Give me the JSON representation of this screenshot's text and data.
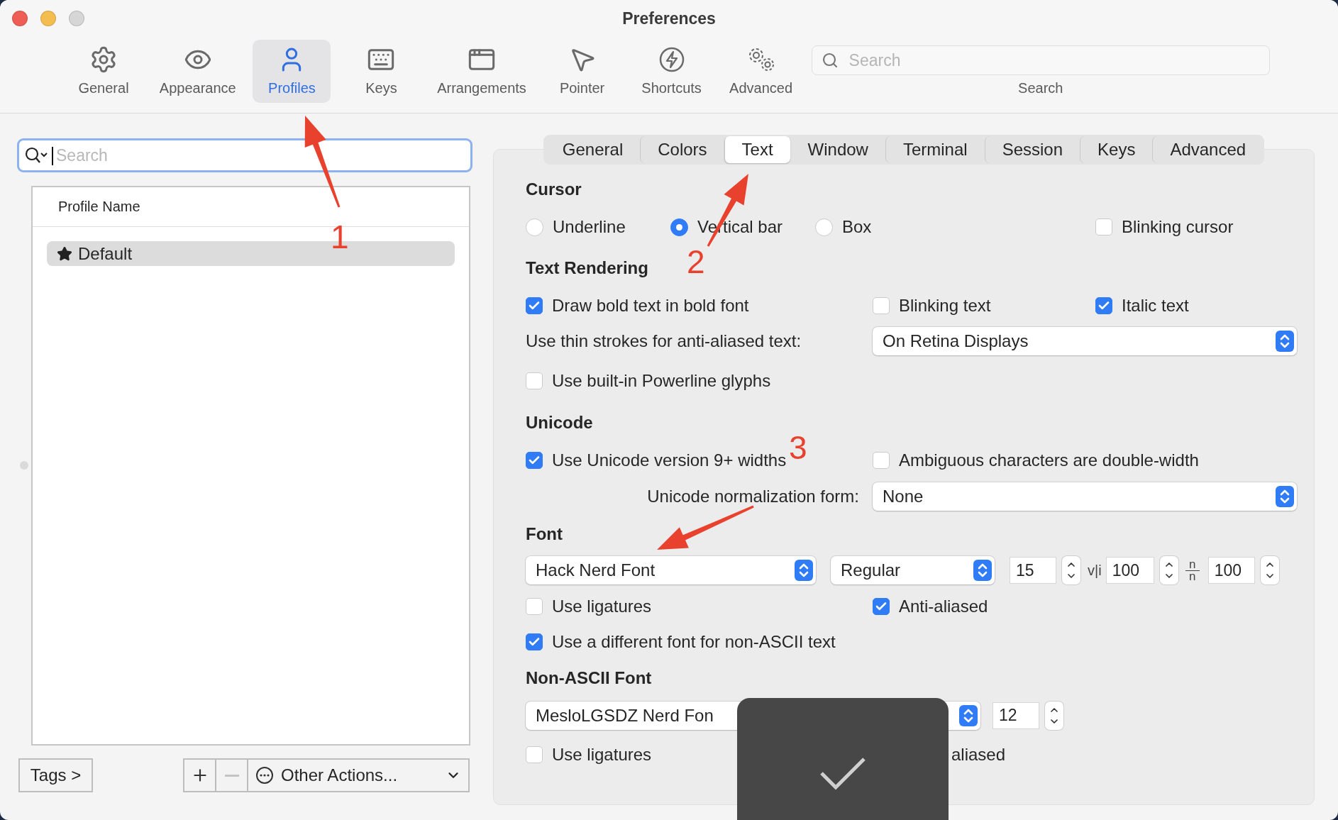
{
  "window": {
    "title": "Preferences",
    "controls": [
      {
        "kind": "close"
      },
      {
        "kind": "minimize"
      },
      {
        "kind": "zoom"
      }
    ]
  },
  "toolbar": {
    "items": [
      {
        "label": "General",
        "kind": "gear",
        "selected": false
      },
      {
        "label": "Appearance",
        "kind": "eye",
        "selected": false
      },
      {
        "label": "Profiles",
        "kind": "person",
        "selected": true
      },
      {
        "label": "Keys",
        "kind": "keyboard",
        "selected": false
      },
      {
        "label": "Arrangements",
        "kind": "windows",
        "selected": false
      },
      {
        "label": "Pointer",
        "kind": "pointer",
        "selected": false
      },
      {
        "label": "Shortcuts",
        "kind": "bolt",
        "selected": false
      },
      {
        "label": "Advanced",
        "kind": "gears",
        "selected": false
      }
    ],
    "search": {
      "placeholder": "Search",
      "label": "Search"
    }
  },
  "profiles": {
    "search": {
      "placeholder": "Search"
    },
    "column": "Profile Name",
    "rows": [
      {
        "name": "Default",
        "default": true,
        "selected": true
      }
    ],
    "tags_button": "Tags >",
    "remove_disabled": true,
    "other_actions": "Other Actions..."
  },
  "tabs": [
    {
      "label": "General",
      "selected": false
    },
    {
      "label": "Colors",
      "selected": false
    },
    {
      "label": "Text",
      "selected": true
    },
    {
      "label": "Window",
      "selected": false
    },
    {
      "label": "Terminal",
      "selected": false
    },
    {
      "label": "Session",
      "selected": false
    },
    {
      "label": "Keys",
      "selected": false
    },
    {
      "label": "Advanced",
      "selected": false
    }
  ],
  "cursor": {
    "heading": "Cursor",
    "shapes": [
      {
        "label": "Underline",
        "selected": false
      },
      {
        "label": "Vertical bar",
        "selected": true
      },
      {
        "label": "Box",
        "selected": false
      }
    ],
    "blinking": {
      "label": "Blinking cursor",
      "checked": false
    }
  },
  "text_rendering": {
    "heading": "Text Rendering",
    "options": [
      {
        "label": "Draw bold text in bold font",
        "checked": true
      },
      {
        "label": "Blinking text",
        "checked": false
      },
      {
        "label": "Italic text",
        "checked": true
      }
    ],
    "thin_strokes": {
      "label": "Use thin strokes for anti-aliased text:",
      "value": "On Retina Displays"
    },
    "powerline": {
      "label": "Use built-in Powerline glyphs",
      "checked": false
    }
  },
  "unicode": {
    "heading": "Unicode",
    "options": [
      {
        "label": "Use Unicode version 9+ widths",
        "checked": true
      },
      {
        "label": "Ambiguous characters are double-width",
        "checked": false
      }
    ],
    "normalization": {
      "label": "Unicode normalization form:",
      "value": "None"
    }
  },
  "font": {
    "heading": "Font",
    "family": "Hack Nerd Font",
    "style": "Regular",
    "size": "15",
    "vertical_symbol": "v|i",
    "vertical_spacing": "100",
    "horizontal_symbol": {
      "top": "n",
      "bottom": "n"
    },
    "horizontal_spacing": "100",
    "options": [
      {
        "label": "Use ligatures",
        "checked": false
      },
      {
        "label": "Anti-aliased",
        "checked": true
      }
    ],
    "non_ascii": {
      "label": "Use a different font for non-ASCII text",
      "checked": true
    }
  },
  "non_ascii_font": {
    "heading": "Non-ASCII Font",
    "family": "MesloLGSDZ Nerd Fon",
    "size": "12",
    "ligatures": {
      "label": "Use ligatures",
      "checked": false
    },
    "covered_label": "aliased"
  },
  "hud": {
    "kind": "check"
  },
  "annotations": [
    {
      "kind": "arrow",
      "label": "1"
    },
    {
      "kind": "arrow",
      "label": "2"
    },
    {
      "kind": "arrow",
      "label": "3"
    }
  ]
}
